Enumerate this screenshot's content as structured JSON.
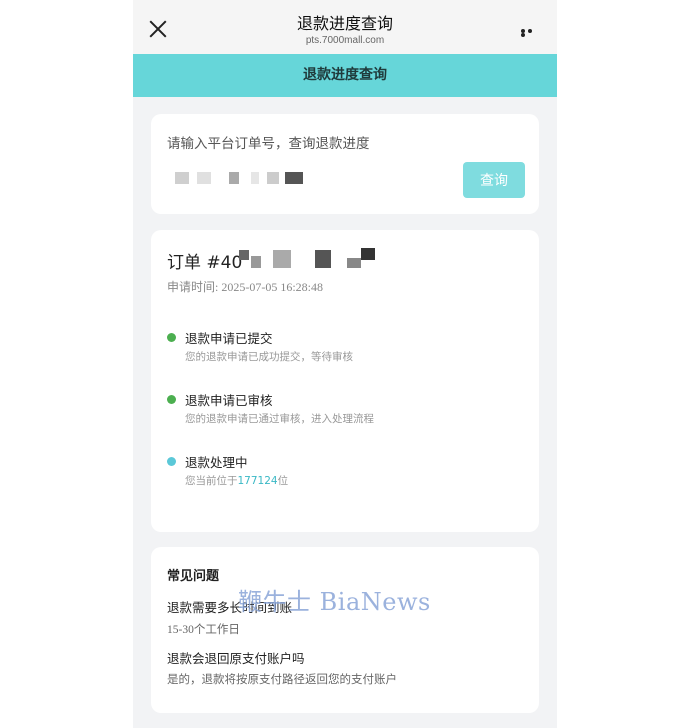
{
  "topbar": {
    "title": "退款进度查询",
    "url": "pts.7000mall.com"
  },
  "header": {
    "title": "退款进度查询"
  },
  "search": {
    "label": "请输入平台订单号，查询退款进度",
    "button_label": "查询"
  },
  "order": {
    "title_prefix": "订单 #40",
    "apply_time": "申请时间: 2025-07-05 16:28:48"
  },
  "steps": [
    {
      "title": "退款申请已提交",
      "desc": "您的退款申请已成功提交，等待审核",
      "dot_color": "#4caf50"
    },
    {
      "title": "退款申请已审核",
      "desc": "您的退款申请已通过审核，进入处理流程",
      "dot_color": "#4caf50"
    },
    {
      "title": "退款处理中",
      "desc_prefix": "您当前位于",
      "queue_position": "177124",
      "desc_suffix": "位",
      "dot_color": "#5bc8d8"
    }
  ],
  "faq": {
    "heading": "常见问题",
    "items": [
      {
        "q": "退款需要多长时间到账",
        "a": "15-30个工作日"
      },
      {
        "q": "退款会退回原支付账户吗",
        "a": "是的，退款将按原支付路径返回您的支付账户"
      }
    ]
  },
  "watermark": "鞭牛士 BiaNews",
  "colors": {
    "accent": "#66d6d9",
    "button": "#7fdcdf",
    "done": "#4caf50",
    "active": "#5bc8d8"
  }
}
